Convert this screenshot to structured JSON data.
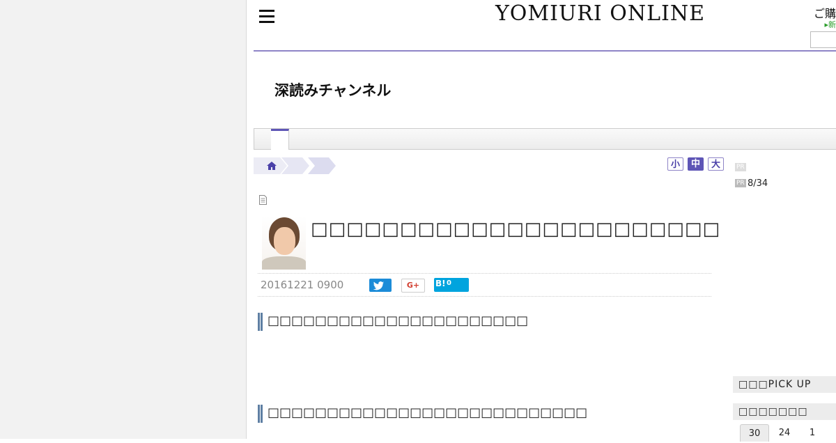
{
  "header": {
    "logo": "YOMIURI ONLINE",
    "login_text": "ご購",
    "login_sub": "▸新",
    "search_placeholder": ""
  },
  "channel": {
    "title": "深読みチャンネル"
  },
  "tabs": [
    {
      "label": ""
    },
    {
      "label": ""
    }
  ],
  "font_size": {
    "small": "小",
    "medium": "中",
    "large": "大",
    "selected": "中"
  },
  "pr": {
    "badge": "PR",
    "counter": "8/34"
  },
  "article": {
    "title": "□□□□□□□□□□□□□□□□□□□□□□□",
    "date": "20161221 0900",
    "share": {
      "google_plus": "G+",
      "hatena_label": "B!",
      "hatena_count": "0"
    },
    "headings": [
      "□□□□□□□□□□□□□□□□□□□□□□",
      "□□□□□□□□□□□□□□□□□□□□□□□□□□□"
    ]
  },
  "sidebar": {
    "pickup": "□□□PICK UP",
    "ranking_title": "□□□□□□□",
    "ranking_tabs": [
      "30",
      "24",
      "1"
    ]
  },
  "icons": {
    "menu": "hamburger-icon",
    "home": "home-icon",
    "document": "document-icon",
    "twitter": "twitter-icon"
  },
  "colors": {
    "accent": "#5e55b6",
    "header_line": "#8e84c7",
    "twitter": "#1c8cd8",
    "hatena": "#00a4de",
    "gplus": "#d23f31"
  }
}
